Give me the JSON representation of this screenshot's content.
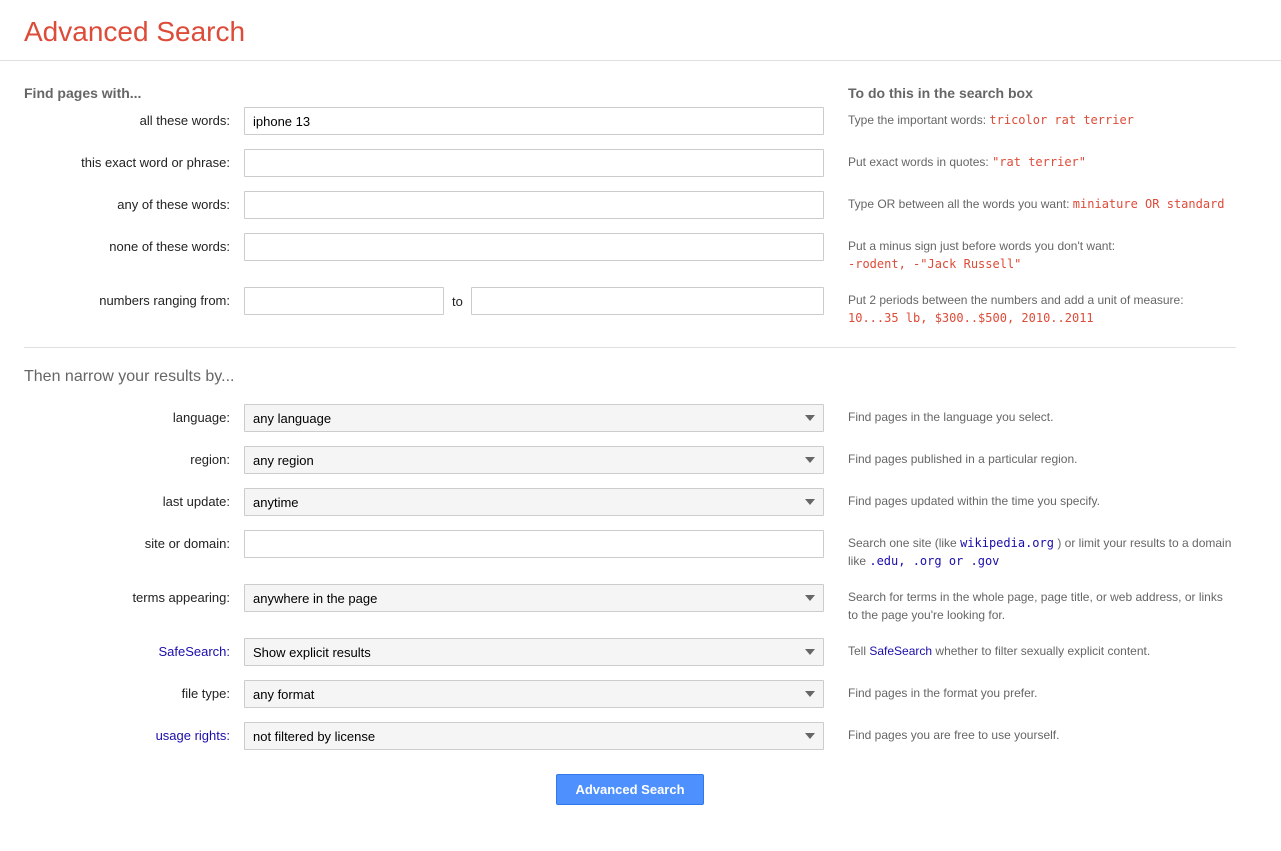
{
  "page_title": "Advanced Search",
  "header": {
    "title": "Advanced Search"
  },
  "find_section": {
    "title": "Find pages with...",
    "right_header": "To do this in the search box"
  },
  "fields": {
    "all_words": {
      "label": "all these words:",
      "value": "iphone 13",
      "placeholder": "",
      "info": "Type the important words:",
      "info_example": "tricolor rat terrier"
    },
    "exact_phrase": {
      "label": "this exact word or phrase:",
      "value": "",
      "placeholder": "",
      "info": "Put exact words in quotes:",
      "info_example": "\"rat terrier\""
    },
    "any_words": {
      "label": "any of these words:",
      "value": "",
      "placeholder": "",
      "info": "Type OR between all the words you want:",
      "info_example": "miniature OR standard"
    },
    "none_words": {
      "label": "none of these words:",
      "value": "",
      "placeholder": "",
      "info": "Put a minus sign just before words you don't want:",
      "info_example1": "-rodent, -\"Jack Russell\""
    },
    "numbers": {
      "label": "numbers ranging from:",
      "to_label": "to",
      "value_from": "",
      "value_to": "",
      "info": "Put 2 periods between the numbers and add a unit of measure:",
      "info_example": "10...35 lb, $300..$500, 2010..2011"
    }
  },
  "narrow_section": {
    "title": "Then narrow your results by..."
  },
  "dropdowns": {
    "language": {
      "label": "language:",
      "selected": "any language",
      "info": "Find pages in the language you select."
    },
    "region": {
      "label": "region:",
      "selected": "any region",
      "info": "Find pages published in a particular region."
    },
    "last_update": {
      "label": "last update:",
      "selected": "anytime",
      "info": "Find pages updated within the time you specify."
    },
    "site_domain": {
      "label": "site or domain:",
      "value": "",
      "info_part1": "Search one site (like",
      "info_site": "wikipedia.org",
      "info_part2": ") or limit your results to a domain like",
      "info_domains": ".edu, .org or .gov"
    },
    "terms": {
      "label": "terms appearing:",
      "selected": "anywhere in the page",
      "info": "Search for terms in the whole page, page title, or web address, or links to the page you're looking for."
    },
    "safesearch": {
      "label": "SafeSearch:",
      "selected": "Show explicit results",
      "info_part1": "Tell",
      "info_safesearch": "SafeSearch",
      "info_part2": "whether to filter sexually explicit content."
    },
    "filetype": {
      "label": "file type:",
      "selected": "any format",
      "info": "Find pages in the format you prefer."
    },
    "usage_rights": {
      "label": "usage rights:",
      "selected": "not filtered by license",
      "info": "Find pages you are free to use yourself."
    }
  },
  "button": {
    "label": "Advanced Search"
  }
}
